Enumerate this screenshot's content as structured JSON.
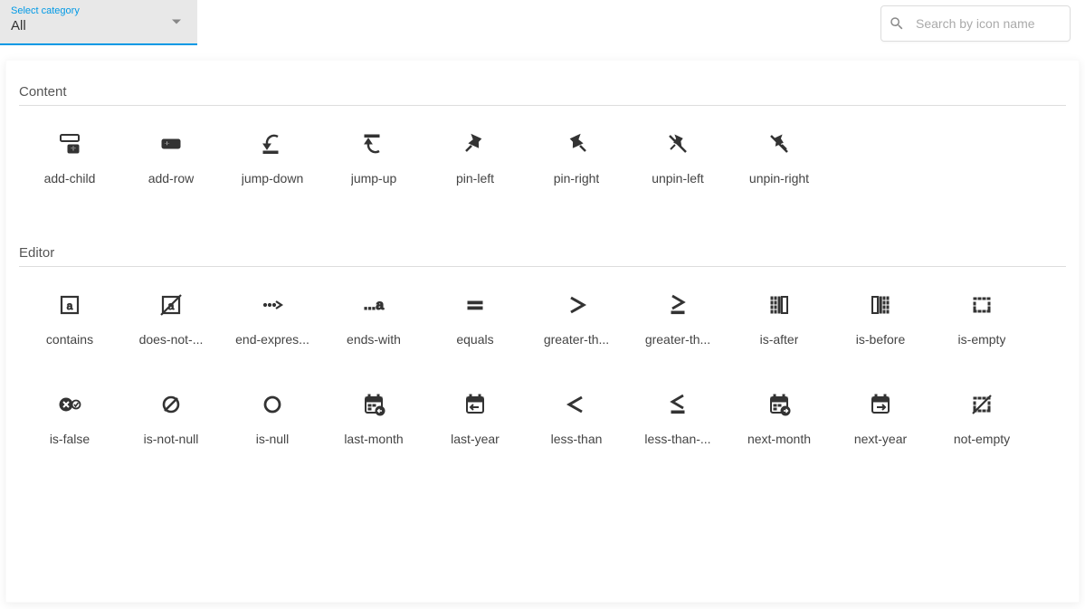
{
  "header": {
    "category_label": "Select category",
    "category_value": "All",
    "search_placeholder": "Search by icon name"
  },
  "sections": [
    {
      "title": "Content",
      "icons": [
        {
          "id": "add-child",
          "label": "add-child"
        },
        {
          "id": "add-row",
          "label": "add-row"
        },
        {
          "id": "jump-down",
          "label": "jump-down"
        },
        {
          "id": "jump-up",
          "label": "jump-up"
        },
        {
          "id": "pin-left",
          "label": "pin-left"
        },
        {
          "id": "pin-right",
          "label": "pin-right"
        },
        {
          "id": "unpin-left",
          "label": "unpin-left"
        },
        {
          "id": "unpin-right",
          "label": "unpin-right"
        }
      ]
    },
    {
      "title": "Editor",
      "icons": [
        {
          "id": "contains",
          "label": "contains"
        },
        {
          "id": "does-not-contain",
          "label": "does-not-..."
        },
        {
          "id": "end-expression",
          "label": "end-expres..."
        },
        {
          "id": "ends-with",
          "label": "ends-with"
        },
        {
          "id": "equals",
          "label": "equals"
        },
        {
          "id": "greater-than",
          "label": "greater-th..."
        },
        {
          "id": "greater-than-or-equal",
          "label": "greater-th..."
        },
        {
          "id": "is-after",
          "label": "is-after"
        },
        {
          "id": "is-before",
          "label": "is-before"
        },
        {
          "id": "is-empty",
          "label": "is-empty"
        },
        {
          "id": "is-false",
          "label": "is-false"
        },
        {
          "id": "is-not-null",
          "label": "is-not-null"
        },
        {
          "id": "is-null",
          "label": "is-null"
        },
        {
          "id": "last-month",
          "label": "last-month"
        },
        {
          "id": "last-year",
          "label": "last-year"
        },
        {
          "id": "less-than",
          "label": "less-than"
        },
        {
          "id": "less-than-or-equal",
          "label": "less-than-..."
        },
        {
          "id": "next-month",
          "label": "next-month"
        },
        {
          "id": "next-year",
          "label": "next-year"
        },
        {
          "id": "not-empty",
          "label": "not-empty"
        }
      ]
    }
  ]
}
